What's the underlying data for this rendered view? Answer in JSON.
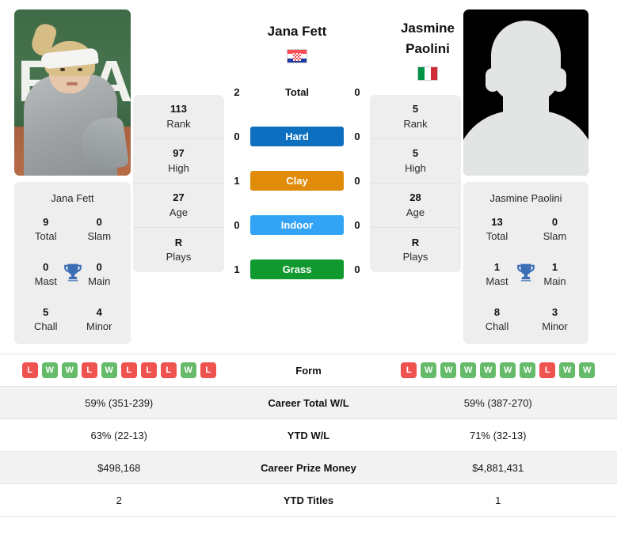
{
  "left_player": {
    "name": "Jana Fett",
    "flag": "croatia-flag",
    "photo_alt": "Jana Fett",
    "card_name": "Jana Fett",
    "titles": [
      {
        "num": "9",
        "label": "Total"
      },
      {
        "num": "0",
        "label": "Slam"
      },
      {
        "num": "0",
        "label": "Mast"
      },
      {
        "num": "0",
        "label": "Main"
      },
      {
        "num": "5",
        "label": "Chall"
      },
      {
        "num": "4",
        "label": "Minor"
      }
    ],
    "meta": [
      {
        "num": "113",
        "label": "Rank"
      },
      {
        "num": "97",
        "label": "High"
      },
      {
        "num": "27",
        "label": "Age"
      },
      {
        "num": "R",
        "label": "Plays"
      }
    ],
    "form": [
      "L",
      "W",
      "W",
      "L",
      "W",
      "L",
      "L",
      "L",
      "W",
      "L"
    ],
    "career_total_wl": "59% (351-239)",
    "ytd_wl": "63% (22-13)",
    "career_prize_money": "$498,168",
    "ytd_titles": "2"
  },
  "right_player": {
    "name_line1": "Jasmine",
    "name_line2": "Paolini",
    "flag": "italy-flag",
    "photo_alt": "Jasmine Paolini",
    "card_name": "Jasmine Paolini",
    "titles": [
      {
        "num": "13",
        "label": "Total"
      },
      {
        "num": "0",
        "label": "Slam"
      },
      {
        "num": "1",
        "label": "Mast"
      },
      {
        "num": "1",
        "label": "Main"
      },
      {
        "num": "8",
        "label": "Chall"
      },
      {
        "num": "3",
        "label": "Minor"
      }
    ],
    "meta": [
      {
        "num": "5",
        "label": "Rank"
      },
      {
        "num": "5",
        "label": "High"
      },
      {
        "num": "28",
        "label": "Age"
      },
      {
        "num": "R",
        "label": "Plays"
      }
    ],
    "form": [
      "L",
      "W",
      "W",
      "W",
      "W",
      "W",
      "W",
      "L",
      "W",
      "W"
    ],
    "career_total_wl": "59% (387-270)",
    "ytd_wl": "71% (32-13)",
    "career_prize_money": "$4,881,431",
    "ytd_titles": "1"
  },
  "head_to_head": [
    {
      "left": "2",
      "label": "Total",
      "right": "0",
      "type": "plain",
      "color": ""
    },
    {
      "left": "0",
      "label": "Hard",
      "right": "0",
      "type": "pill",
      "color": "#0d6fc0"
    },
    {
      "left": "1",
      "label": "Clay",
      "right": "0",
      "type": "pill",
      "color": "#e08c0a"
    },
    {
      "left": "0",
      "label": "Indoor",
      "right": "0",
      "type": "pill",
      "color": "#33a3f5"
    },
    {
      "left": "1",
      "label": "Grass",
      "right": "0",
      "type": "pill",
      "color": "#10992f"
    }
  ],
  "comparison_rows": [
    {
      "label": "Form"
    },
    {
      "label": "Career Total W/L"
    },
    {
      "label": "YTD W/L"
    },
    {
      "label": "Career Prize Money"
    },
    {
      "label": "YTD Titles"
    }
  ],
  "colors": {
    "panel_bg": "#eeeeee",
    "row_stripe": "#f2f2f2",
    "win_badge": "#66bb6a",
    "loss_badge": "#ef5350",
    "trophy": "#3b6eb4",
    "hard": "#0d6fc0",
    "clay": "#e08c0a",
    "indoor": "#33a3f5",
    "grass": "#10992f"
  }
}
